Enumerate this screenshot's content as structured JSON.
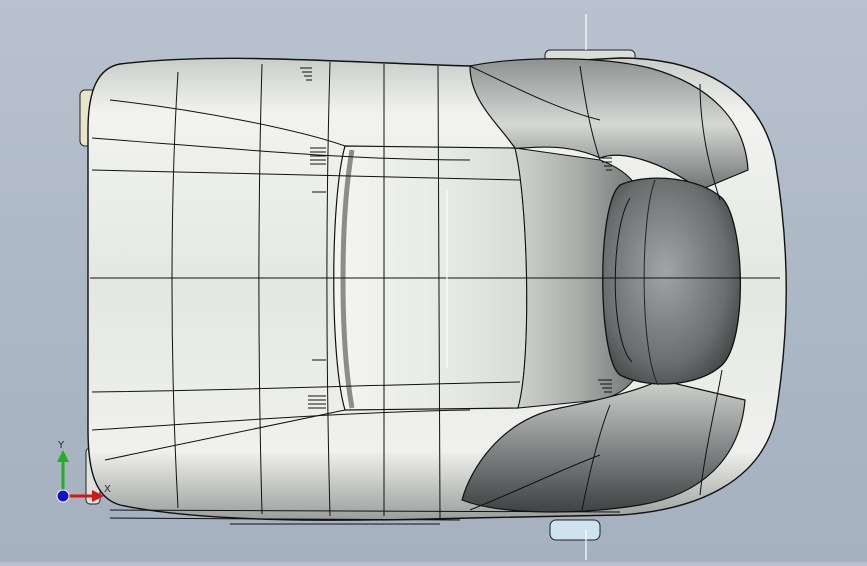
{
  "viewport": {
    "background_top": "#b9c3cf",
    "background_bottom": "#a5b1bf",
    "model": "car-seat-top-view",
    "edge_color": "#111111",
    "body_color": "#e8ebe6",
    "shadow_color": "#55585a"
  },
  "triad": {
    "x_label": "X",
    "y_label": "Y",
    "x_color": "#d01818",
    "y_color": "#20b020",
    "z_color": "#1010d0"
  }
}
